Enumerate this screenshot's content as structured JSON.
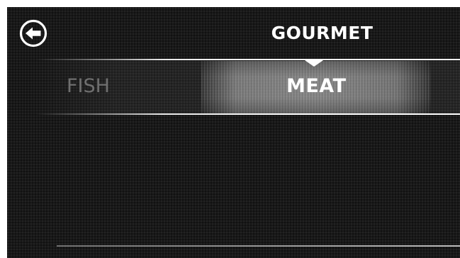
{
  "header": {
    "title": "GOURMET",
    "back_icon": "back-arrow-circle-icon"
  },
  "carousel": {
    "items": [
      {
        "label": "FISH",
        "state": "inactive"
      },
      {
        "label": "MEAT",
        "state": "selected"
      }
    ],
    "selected_index": 1,
    "pointer_icon": "triangle-down-icon"
  },
  "colors": {
    "background": "#191919",
    "text_active": "#ffffff",
    "text_inactive": "#6f6f6f"
  }
}
